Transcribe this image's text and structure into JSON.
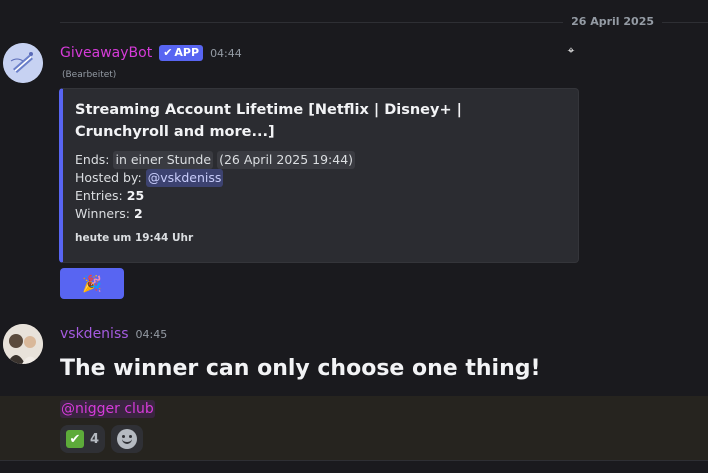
{
  "date_divider": "26 April 2025",
  "bot_message": {
    "username": "GiveawayBot",
    "app_tag": "APP",
    "timestamp": "04:44",
    "edited": "(Bearbeitet)",
    "embed": {
      "title": "Streaming Account Lifetime [Netflix | Disney+ | Crunchyroll and more...]",
      "ends_label": "Ends:",
      "ends_relative": "in einer Stunde",
      "ends_absolute": "(26 April 2025 19:44)",
      "hosted_label": "Hosted by:",
      "host": "@vskdeniss",
      "entries_label": "Entries:",
      "entries": "25",
      "winners_label": "Winners:",
      "winners": "2",
      "footer": "heute um 19:44 Uhr",
      "accent_color": "#5865f2"
    },
    "button_icon": "party-popper-icon",
    "button_emoji": "🎉"
  },
  "user_message": {
    "username": "vskdeniss",
    "timestamp": "04:45",
    "text": "The winner can only choose one thing!",
    "mention": "@nigger club",
    "reactions": [
      {
        "icon": "white-check-mark-icon",
        "count": "4"
      },
      {
        "icon": "add-reaction-icon"
      }
    ]
  },
  "colors": {
    "background": "#1a1a1e",
    "bot_name": "#d53bd8",
    "user_name": "#a55be0",
    "blurple": "#5865f2"
  }
}
